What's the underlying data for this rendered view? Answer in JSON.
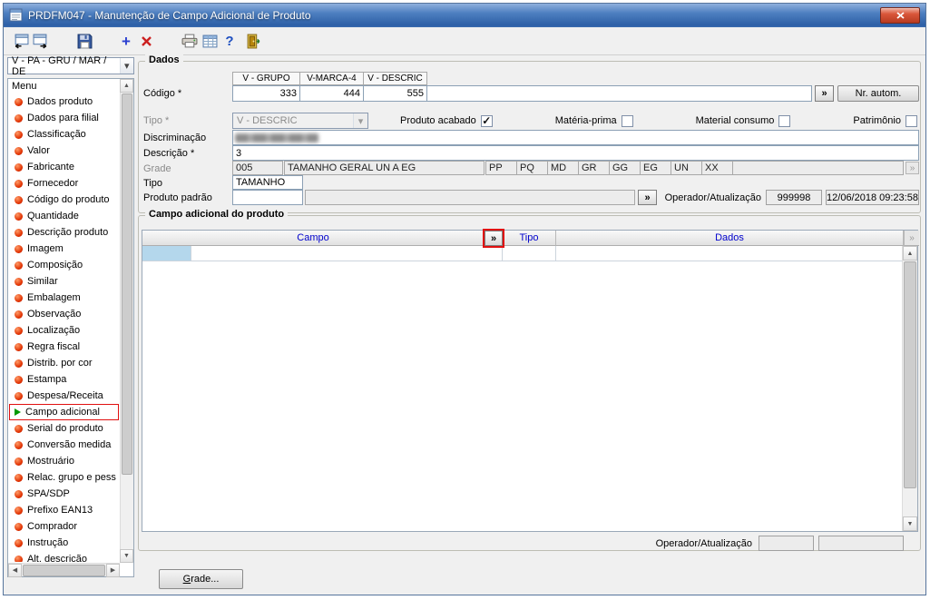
{
  "window": {
    "title": "PRDFM047 - Manutenção de Campo Adicional de Produto"
  },
  "icons": {
    "up": "▲",
    "down": "▼",
    "left": "◀",
    "right": "▶",
    "combo_arrow": "▾",
    "check": "✓"
  },
  "toolbar": {
    "icons": [
      "records-prev-icon",
      "records-next-icon",
      "save-icon",
      "add-icon",
      "delete-icon",
      "print-icon",
      "table-icon",
      "help-icon",
      "exit-icon"
    ],
    "add_glyph": "+",
    "help_glyph": "?"
  },
  "sidebar": {
    "view_combo": {
      "value": "V - PA - GRU / MAR / DE"
    },
    "menu_title": "Menu",
    "items": [
      {
        "label": "Dados produto"
      },
      {
        "label": "Dados para filial"
      },
      {
        "label": "Classificação"
      },
      {
        "label": "Valor"
      },
      {
        "label": "Fabricante"
      },
      {
        "label": "Fornecedor"
      },
      {
        "label": "Código do produto"
      },
      {
        "label": "Quantidade"
      },
      {
        "label": "Descrição produto"
      },
      {
        "label": "Imagem"
      },
      {
        "label": "Composição"
      },
      {
        "label": "Similar"
      },
      {
        "label": "Embalagem"
      },
      {
        "label": "Observação"
      },
      {
        "label": "Localização"
      },
      {
        "label": "Regra fiscal"
      },
      {
        "label": "Distrib. por cor"
      },
      {
        "label": "Estampa"
      },
      {
        "label": "Despesa/Receita"
      },
      {
        "label": "Campo adicional",
        "selected": true
      },
      {
        "label": "Serial do produto"
      },
      {
        "label": "Conversão medida"
      },
      {
        "label": "Mostruário"
      },
      {
        "label": "Relac. grupo e pess"
      },
      {
        "label": "SPA/SDP"
      },
      {
        "label": "Prefixo EAN13"
      },
      {
        "label": "Comprador"
      },
      {
        "label": "Instrução"
      },
      {
        "label": "Alt. descrição"
      }
    ]
  },
  "dados": {
    "title": "Dados",
    "column_headers": [
      "V - GRUPO",
      "V-MARCA-4",
      "V - DESCRIC"
    ],
    "codigo_label": "Código *",
    "codigo_values": [
      "333",
      "444",
      "555"
    ],
    "codigo_extra_value": "",
    "more_button": "»",
    "nr_autom_button": "Nr. autom.",
    "tipo_label": "Tipo *",
    "tipo_value": "V - DESCRIC",
    "checkboxes": [
      {
        "label": "Produto acabado",
        "checked": true
      },
      {
        "label": "Matéria-prima",
        "checked": false
      },
      {
        "label": "Material consumo",
        "checked": false
      },
      {
        "label": "Patrimônio",
        "checked": false
      }
    ],
    "discriminacao_label": "Discriminação",
    "descricao_label": "Descrição *",
    "descricao_value": "3",
    "grade_label": "Grade",
    "grade_code": "005",
    "grade_desc": "TAMANHO GERAL UN A EG",
    "grade_sizes": [
      "PP",
      "PQ",
      "MD",
      "GR",
      "GG",
      "EG",
      "UN",
      "XX"
    ],
    "tipo2_label": "Tipo",
    "tipo2_value": "TAMANHO",
    "produto_padrao_label": "Produto padrão",
    "produto_padrao_value": "",
    "operador_label": "Operador/Atualização",
    "operador_value": "999998",
    "operador_datetime": "12/06/2018 09:23:58"
  },
  "campo_adicional": {
    "title": "Campo adicional do produto",
    "col_campo": "Campo",
    "col_tipo": "Tipo",
    "col_dados": "Dados",
    "more_button": "»",
    "rows": [
      {
        "campo": "",
        "tipo": "",
        "dados": ""
      }
    ],
    "operador_label": "Operador/Atualização",
    "operador_value": "",
    "operador_datetime": ""
  },
  "footer": {
    "grade_button": "Grade..."
  },
  "colors": {
    "titlebar_blue": "#2d5fa6",
    "annotation_red": "#e01010",
    "grid_header_text": "#0000cc",
    "row_selector_blue": "#b4d7ec",
    "bullet_orange": "#e03000"
  }
}
